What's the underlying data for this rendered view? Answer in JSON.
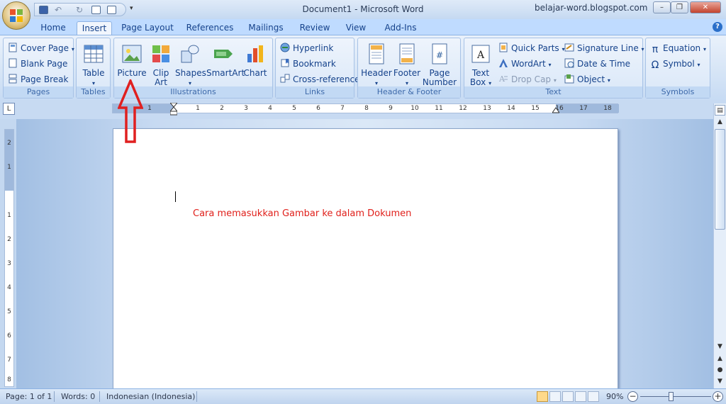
{
  "window": {
    "title": "Document1 - Microsoft Word",
    "watermark": "belajar-word.blogspot.com"
  },
  "tabs": [
    "Home",
    "Insert",
    "Page Layout",
    "References",
    "Mailings",
    "Review",
    "View",
    "Add-Ins"
  ],
  "active_tab": "Insert",
  "groups": {
    "pages": {
      "label": "Pages",
      "cover_page": "Cover Page",
      "blank_page": "Blank Page",
      "page_break": "Page Break"
    },
    "tables": {
      "label": "Tables",
      "table": "Table"
    },
    "illustrations": {
      "label": "Illustrations",
      "picture": "Picture",
      "clip_art_1": "Clip",
      "clip_art_2": "Art",
      "shapes": "Shapes",
      "smartart": "SmartArt",
      "chart": "Chart"
    },
    "links": {
      "label": "Links",
      "hyperlink": "Hyperlink",
      "bookmark": "Bookmark",
      "cross_reference": "Cross-reference"
    },
    "header_footer": {
      "label": "Header & Footer",
      "header": "Header",
      "footer": "Footer",
      "page_number_1": "Page",
      "page_number_2": "Number"
    },
    "text": {
      "label": "Text",
      "text_box_1": "Text",
      "text_box_2": "Box",
      "quick_parts": "Quick Parts",
      "wordart": "WordArt",
      "drop_cap": "Drop Cap",
      "signature_line": "Signature Line",
      "date_time": "Date & Time",
      "object": "Object"
    },
    "symbols": {
      "label": "Symbols",
      "equation": "Equation",
      "symbol": "Symbol"
    }
  },
  "ruler_ticks": [
    "1",
    "1",
    "2",
    "3",
    "4",
    "5",
    "6",
    "7",
    "8",
    "9",
    "10",
    "11",
    "12",
    "13",
    "14",
    "15",
    "16",
    "17",
    "18"
  ],
  "vruler_ticks": [
    "2",
    "1",
    "1",
    "2",
    "3",
    "4",
    "5",
    "6",
    "7",
    "8"
  ],
  "document": {
    "text": "Cara memasukkan Gambar ke dalam Dokumen",
    "text_color": "#e0201b"
  },
  "status": {
    "page": "Page: 1 of 1",
    "words": "Words: 0",
    "language": "Indonesian (Indonesia)",
    "zoom": "90%"
  },
  "annotation": {
    "arrow_color": "#e02020",
    "points_to": "Picture"
  }
}
